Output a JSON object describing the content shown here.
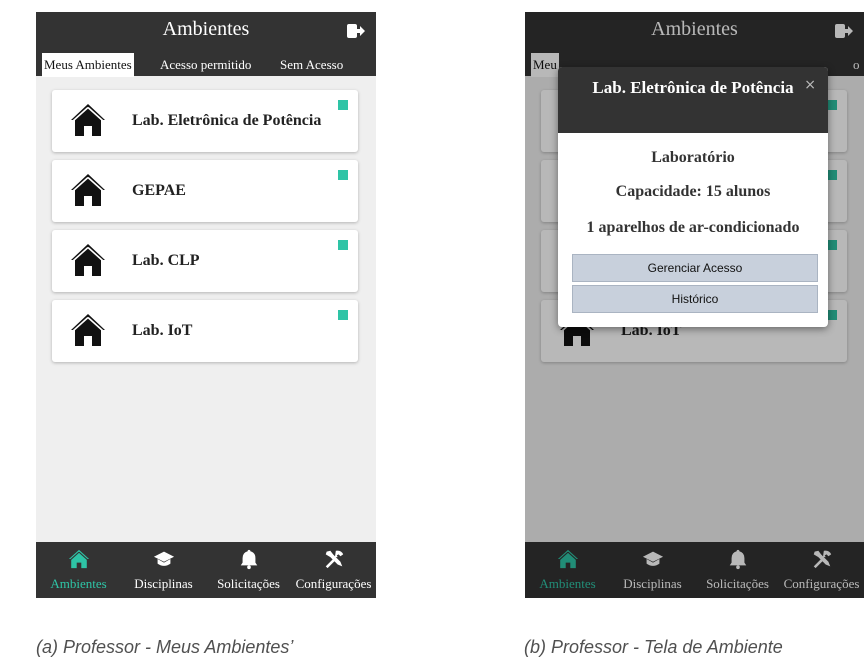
{
  "screens": [
    {
      "header": {
        "title": "Ambientes",
        "logout_icon": "logout-icon"
      },
      "tabs": [
        {
          "label": "Meus Ambientes",
          "active": true
        },
        {
          "label": "Acesso permitido",
          "active": false
        },
        {
          "label": "Sem Acesso",
          "active": false
        }
      ],
      "rooms": [
        {
          "name": "Lab. Eletrônica de Potência",
          "icon": "home-icon"
        },
        {
          "name": "GEPAE",
          "icon": "home-icon"
        },
        {
          "name": "Lab. CLP",
          "icon": "home-icon"
        },
        {
          "name": "Lab. IoT",
          "icon": "home-icon"
        }
      ],
      "nav": [
        {
          "label": "Ambientes",
          "icon": "home-icon",
          "active": true
        },
        {
          "label": "Disciplinas",
          "icon": "graduation-cap-icon",
          "active": false
        },
        {
          "label": "Solicitações",
          "icon": "bell-icon",
          "active": false
        },
        {
          "label": "Configurações",
          "icon": "tools-icon",
          "active": false
        }
      ]
    },
    {
      "header": {
        "title": "Ambientes",
        "logout_icon": "logout-icon"
      },
      "tabs": [
        {
          "label": "Meu",
          "active": true
        },
        {
          "label": "o",
          "active": false
        }
      ],
      "background_rooms": [
        {
          "name": "Lab. IoT",
          "icon": "home-icon"
        }
      ],
      "modal": {
        "title": "Lab. Eletrônica de Potência",
        "close": "×",
        "type": "Laboratório",
        "capacity": "Capacidade: 15 alunos",
        "ac_units": "1 aparelhos de ar-condicionado",
        "manage_button": "Gerenciar Acesso",
        "history_button": "Histórico"
      },
      "nav": [
        {
          "label": "Ambientes",
          "icon": "home-icon",
          "active": true
        },
        {
          "label": "Disciplinas",
          "icon": "graduation-cap-icon",
          "active": false
        },
        {
          "label": "Solicitações",
          "icon": "bell-icon",
          "active": false
        },
        {
          "label": "Configurações",
          "icon": "tools-icon",
          "active": false
        }
      ]
    }
  ],
  "captions": [
    "(a) Professor - Meus Ambientes’",
    "(b) Professor - Tela de Ambiente"
  ],
  "colors": {
    "header_bg": "#333333",
    "accent": "#2ec4a6",
    "background": "#efefef",
    "button_bg": "#c8d0dc"
  }
}
